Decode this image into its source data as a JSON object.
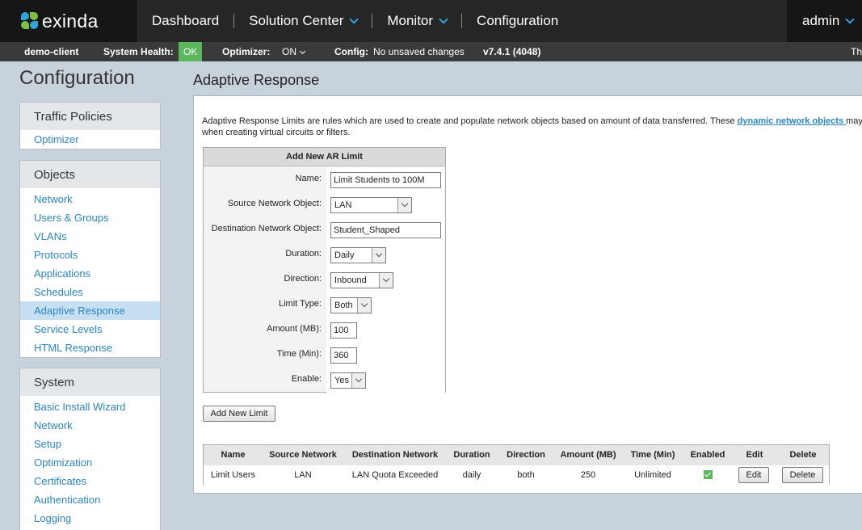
{
  "brand": {
    "logo_text": "exinda"
  },
  "topnav": {
    "items": [
      {
        "label": "Dashboard",
        "has_dropdown": false
      },
      {
        "label": "Solution Center",
        "has_dropdown": true
      },
      {
        "label": "Monitor",
        "has_dropdown": true
      },
      {
        "label": "Configuration",
        "has_dropdown": false
      }
    ],
    "user": "admin"
  },
  "statusbar": {
    "client": "demo-client",
    "health_label": "System Health:",
    "health_value": "OK",
    "optimizer_label": "Optimizer:",
    "optimizer_value": "ON",
    "config_label": "Config:",
    "config_value": "No unsaved changes",
    "version": "v7.4.1 (4048)",
    "truncated_right": "Th"
  },
  "sidebar": {
    "title": "Configuration",
    "sections": [
      {
        "heading": "Traffic Policies",
        "items": [
          "Optimizer"
        ]
      },
      {
        "heading": "Objects",
        "items": [
          "Network",
          "Users & Groups",
          "VLANs",
          "Protocols",
          "Applications",
          "Schedules",
          "Adaptive Response",
          "Service Levels",
          "HTML Response"
        ],
        "active": "Adaptive Response"
      },
      {
        "heading": "System",
        "items": [
          "Basic Install Wizard",
          "Network",
          "Setup",
          "Optimization",
          "Certificates",
          "Authentication",
          "Logging"
        ]
      }
    ]
  },
  "main": {
    "title": "Adaptive Response",
    "description_pre": "Adaptive Response Limits are rules which are used to create and populate network objects based on amount of data transferred. These ",
    "description_link": "dynamic network objects ",
    "description_post": "may",
    "description_line2": "when creating virtual circuits or filters.",
    "form": {
      "heading": "Add New AR Limit",
      "fields": {
        "name": {
          "label": "Name:",
          "value": "Limit Students to 100M"
        },
        "source": {
          "label": "Source Network Object:",
          "value": "LAN"
        },
        "destination": {
          "label": "Destination Network Object:",
          "value": "Student_Shaped"
        },
        "duration": {
          "label": "Duration:",
          "value": "Daily"
        },
        "direction": {
          "label": "Direction:",
          "value": "Inbound"
        },
        "limit_type": {
          "label": "Limit Type:",
          "value": "Both"
        },
        "amount": {
          "label": "Amount (MB):",
          "value": "100"
        },
        "time": {
          "label": "Time (Min):",
          "value": "360"
        },
        "enable": {
          "label": "Enable:",
          "value": "Yes"
        }
      }
    },
    "add_button": "Add New Limit",
    "table": {
      "headers": [
        "Name",
        "Source Network",
        "Destination Network",
        "Duration",
        "Direction",
        "Amount (MB)",
        "Time (Min)",
        "Enabled",
        "Edit",
        "Delete"
      ],
      "rows": [
        {
          "name": "Limit Users",
          "source": "LAN",
          "destination": "LAN Quota Exceeded",
          "duration": "daily",
          "direction": "both",
          "amount": "250",
          "time": "Unlimited",
          "enabled": true,
          "edit": "Edit",
          "delete": "Delete"
        }
      ]
    }
  }
}
